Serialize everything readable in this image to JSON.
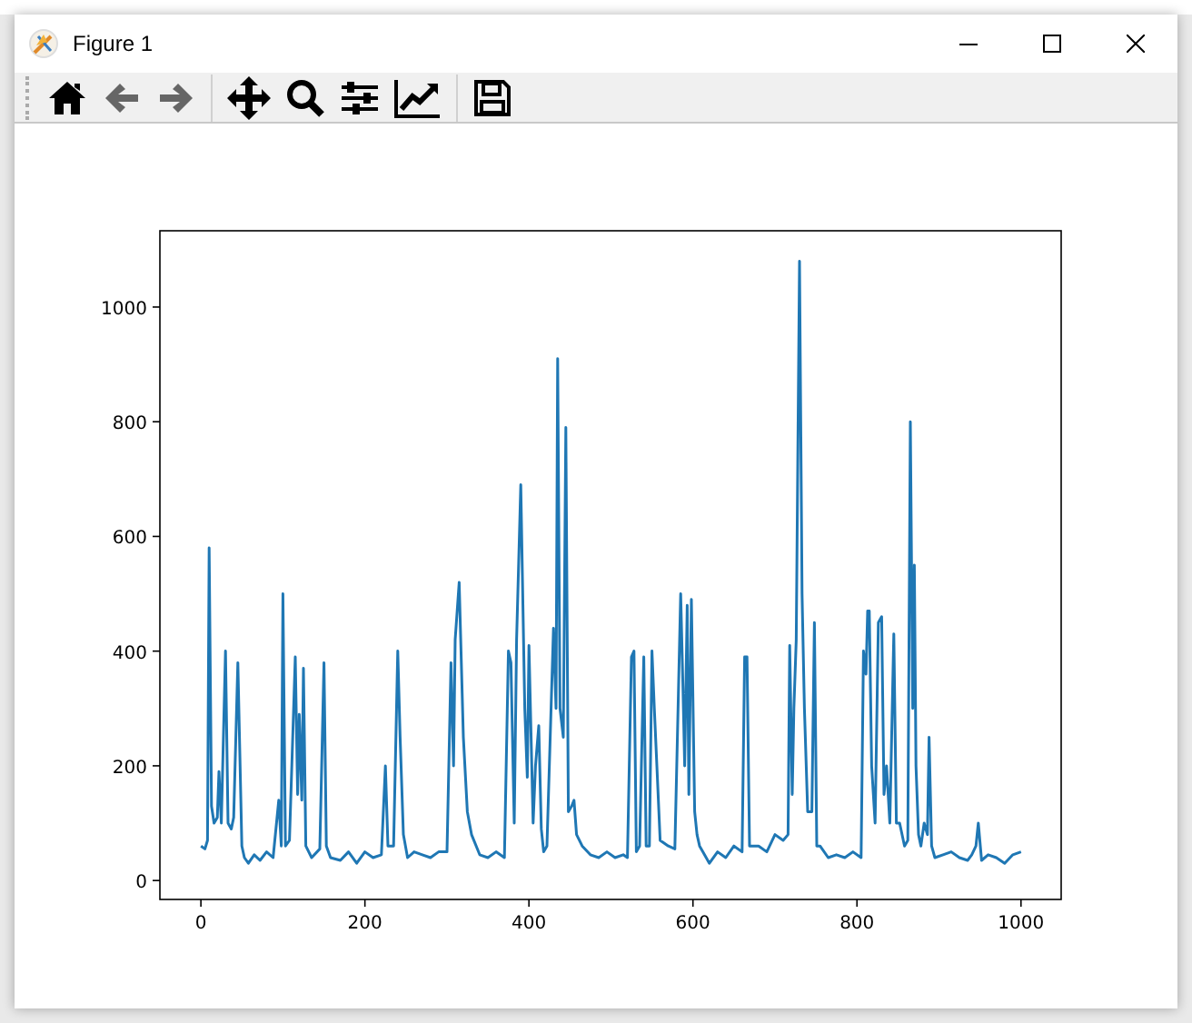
{
  "window": {
    "title": "Figure 1"
  },
  "toolbar": {
    "buttons": [
      {
        "kind": "home"
      },
      {
        "kind": "back"
      },
      {
        "kind": "forward"
      },
      {
        "kind": "pan"
      },
      {
        "kind": "zoom"
      },
      {
        "kind": "subplots"
      },
      {
        "kind": "axes"
      },
      {
        "kind": "save"
      }
    ]
  },
  "chart_data": {
    "type": "line",
    "xlim": [
      -50,
      1049
    ],
    "ylim": [
      -33,
      1133
    ],
    "xticks": [
      0,
      200,
      400,
      600,
      800,
      1000
    ],
    "yticks": [
      0,
      200,
      400,
      600,
      800,
      1000
    ],
    "x": [
      0,
      5,
      8,
      10,
      13,
      16,
      20,
      22,
      25,
      30,
      33,
      37,
      40,
      45,
      50,
      53,
      58,
      65,
      72,
      80,
      88,
      95,
      98,
      100,
      103,
      108,
      115,
      118,
      120,
      123,
      125,
      128,
      135,
      145,
      150,
      153,
      158,
      170,
      180,
      190,
      200,
      210,
      220,
      225,
      228,
      235,
      240,
      243,
      247,
      252,
      260,
      270,
      280,
      290,
      300,
      305,
      308,
      310,
      315,
      320,
      325,
      330,
      340,
      350,
      360,
      370,
      375,
      378,
      382,
      385,
      390,
      395,
      398,
      400,
      405,
      408,
      412,
      415,
      418,
      422,
      430,
      433,
      435,
      438,
      442,
      445,
      448,
      452,
      455,
      458,
      465,
      475,
      485,
      495,
      505,
      515,
      520,
      525,
      528,
      531,
      535,
      540,
      543,
      547,
      550,
      553,
      556,
      560,
      570,
      578,
      585,
      588,
      590,
      593,
      595,
      598,
      602,
      605,
      608,
      612,
      620,
      630,
      640,
      650,
      660,
      663,
      666,
      669,
      672,
      680,
      690,
      700,
      710,
      716,
      718,
      721,
      723,
      726,
      730,
      733,
      736,
      740,
      745,
      748,
      751,
      755,
      765,
      775,
      785,
      795,
      805,
      808,
      811,
      813,
      815,
      818,
      822,
      826,
      830,
      833,
      836,
      840,
      845,
      848,
      852,
      858,
      862,
      865,
      868,
      870,
      872,
      875,
      878,
      882,
      886,
      888,
      891,
      895,
      905,
      915,
      925,
      935,
      940,
      945,
      948,
      952,
      960,
      970,
      980,
      990,
      1000
    ],
    "series": [
      {
        "color": "#1f77b4",
        "values": [
          60,
          55,
          70,
          580,
          130,
          100,
          110,
          190,
          100,
          400,
          100,
          90,
          110,
          380,
          60,
          40,
          30,
          45,
          35,
          50,
          40,
          140,
          60,
          500,
          60,
          70,
          390,
          150,
          290,
          140,
          370,
          60,
          40,
          55,
          380,
          60,
          40,
          35,
          50,
          30,
          50,
          40,
          45,
          200,
          60,
          60,
          400,
          250,
          80,
          40,
          50,
          45,
          40,
          50,
          50,
          380,
          200,
          420,
          520,
          250,
          120,
          80,
          45,
          40,
          50,
          40,
          400,
          380,
          100,
          420,
          690,
          300,
          180,
          410,
          100,
          200,
          270,
          90,
          50,
          60,
          440,
          300,
          910,
          300,
          250,
          790,
          120,
          130,
          140,
          80,
          60,
          45,
          40,
          50,
          40,
          45,
          40,
          390,
          400,
          50,
          60,
          390,
          60,
          60,
          400,
          300,
          200,
          70,
          60,
          55,
          500,
          330,
          200,
          480,
          150,
          490,
          120,
          80,
          60,
          50,
          30,
          50,
          40,
          60,
          50,
          390,
          390,
          60,
          60,
          60,
          50,
          80,
          70,
          80,
          410,
          150,
          300,
          420,
          1080,
          500,
          300,
          120,
          120,
          450,
          60,
          60,
          40,
          45,
          40,
          50,
          40,
          400,
          360,
          470,
          470,
          200,
          100,
          450,
          460,
          150,
          200,
          100,
          430,
          100,
          100,
          60,
          70,
          800,
          300,
          550,
          200,
          80,
          60,
          100,
          80,
          250,
          60,
          40,
          45,
          50,
          40,
          35,
          45,
          60,
          100,
          35,
          45,
          40,
          30,
          45,
          50
        ]
      }
    ]
  }
}
